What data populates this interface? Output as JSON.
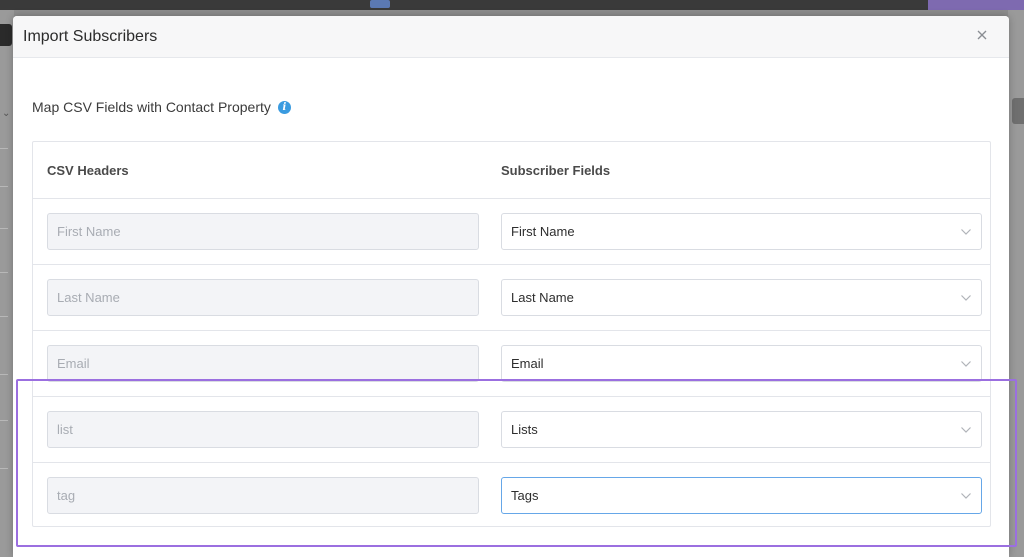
{
  "modal": {
    "title": "Import Subscribers"
  },
  "section": {
    "title": "Map CSV Fields with Contact Property",
    "info_icon_glyph": "i"
  },
  "table": {
    "csv_header": "CSV Headers",
    "subscriber_header": "Subscriber Fields",
    "rows": [
      {
        "csv_value": "First Name",
        "field_value": "First Name"
      },
      {
        "csv_value": "Last Name",
        "field_value": "Last Name"
      },
      {
        "csv_value": "Email",
        "field_value": "Email"
      },
      {
        "csv_value": "list",
        "field_value": "Lists"
      },
      {
        "csv_value": "tag",
        "field_value": "Tags"
      }
    ]
  },
  "colors": {
    "highlight": "#9b6fe0",
    "info": "#3a9be0",
    "focus": "#66a7e8"
  }
}
